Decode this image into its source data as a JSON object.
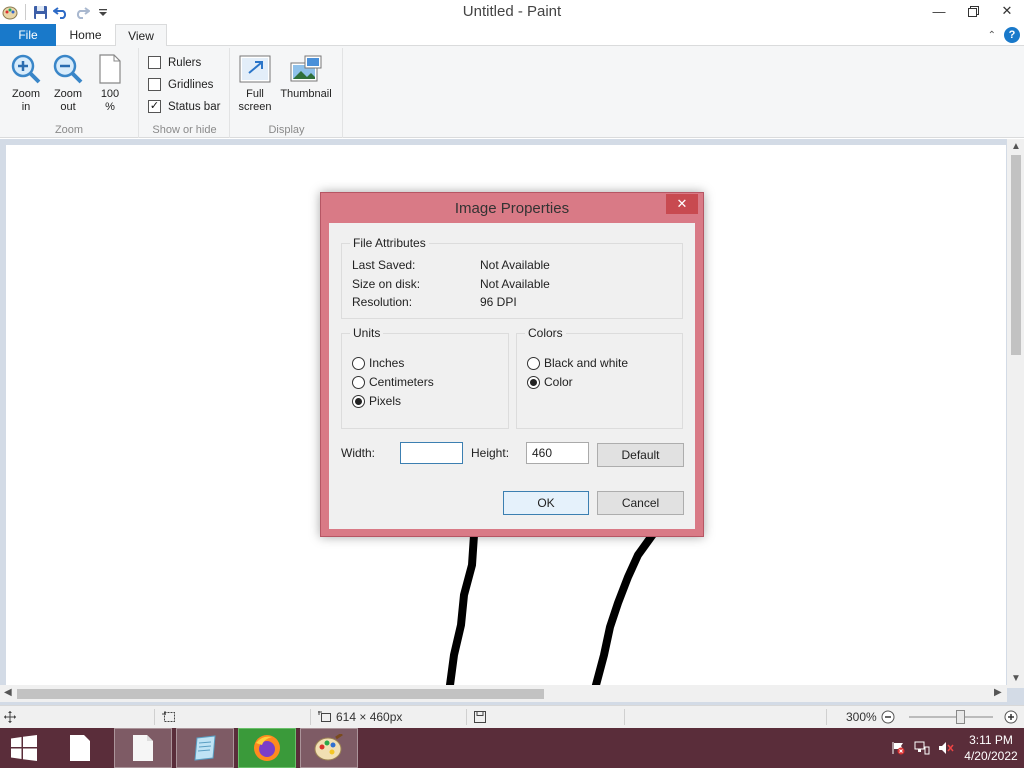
{
  "window": {
    "title": "Untitled - Paint"
  },
  "ribbon": {
    "tabs": [
      "File",
      "Home",
      "View"
    ],
    "zoom_group": {
      "label": "Zoom",
      "zoom_in": [
        "Zoom",
        "in"
      ],
      "zoom_out": [
        "Zoom",
        "out"
      ],
      "hundred": [
        "100",
        "%"
      ]
    },
    "show_hide_group": {
      "label": "Show or hide",
      "rulers": "Rulers",
      "gridlines": "Gridlines",
      "status_bar": "Status bar"
    },
    "display_group": {
      "label": "Display",
      "full_screen": [
        "Full",
        "screen"
      ],
      "thumbnail": "Thumbnail"
    }
  },
  "dialog": {
    "title": "Image Properties",
    "file_attributes": {
      "legend": "File Attributes",
      "rows": [
        {
          "key": "Last Saved:",
          "value": "Not Available"
        },
        {
          "key": "Size on disk:",
          "value": "Not Available"
        },
        {
          "key": "Resolution:",
          "value": "96 DPI"
        }
      ]
    },
    "units": {
      "legend": "Units",
      "inches": "Inches",
      "centimeters": "Centimeters",
      "pixels": "Pixels",
      "selected": "Pixels"
    },
    "colors": {
      "legend": "Colors",
      "black_and_white": "Black and white",
      "color": "Color",
      "selected": "Color"
    },
    "width_label": "Width:",
    "width_value": "",
    "height_label": "Height:",
    "height_value": "460",
    "default_button": "Default",
    "ok_button": "OK",
    "cancel_button": "Cancel"
  },
  "statusbar": {
    "dimensions": "614 × 460px",
    "zoom": "300%"
  },
  "taskbar": {
    "clock_time": "3:11 PM",
    "clock_date": "4/20/2022"
  },
  "colors": {
    "accent": "#1979ca",
    "dialog_frame": "#d97a86",
    "taskbar": "#5a2d3a"
  }
}
